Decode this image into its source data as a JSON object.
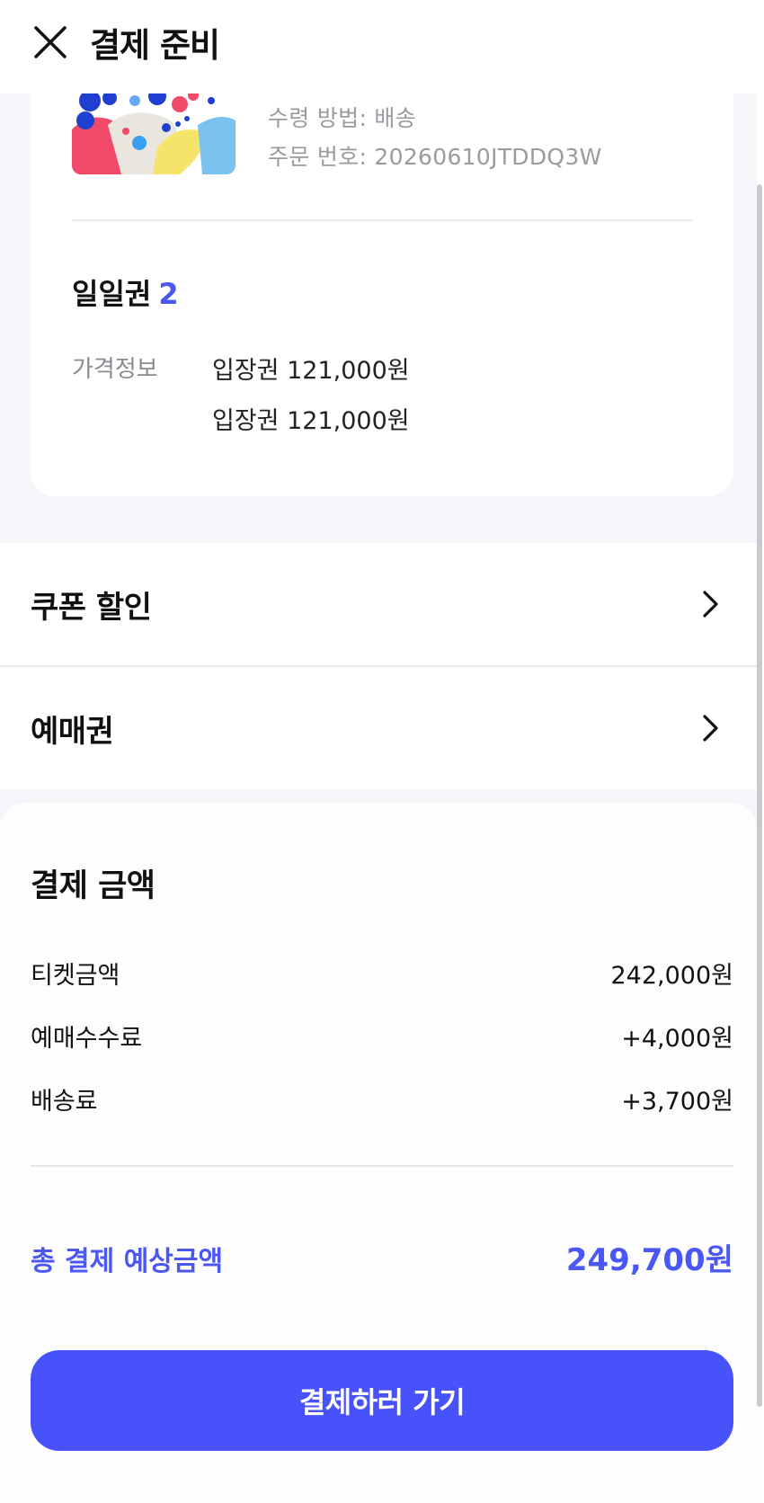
{
  "header": {
    "title": "결제 준비",
    "close_icon": "close-icon"
  },
  "order": {
    "receive_method": "수령 방법: 배송",
    "order_number": "주문 번호: 20260610JTDDQ3W"
  },
  "ticket": {
    "name": "일일권",
    "count": "2",
    "price_label": "가격정보",
    "price_lines": [
      "입장권 121,000원",
      "입장권 121,000원"
    ]
  },
  "menus": {
    "coupon": "쿠폰 할인",
    "voucher": "예매권"
  },
  "payment": {
    "title": "결제 금액",
    "rows": [
      {
        "label": "티켓금액",
        "value": "242,000원"
      },
      {
        "label": "예매수수료",
        "value": "+4,000원"
      },
      {
        "label": "배송료",
        "value": "+3,700원"
      }
    ],
    "total_label": "총 결제 예상금액",
    "total_value": "249,700원"
  },
  "cta": {
    "label": "결제하러 가기"
  },
  "colors": {
    "accent": "#4752fb",
    "total_text": "#4a57f2",
    "background": "#f5f6fa"
  }
}
